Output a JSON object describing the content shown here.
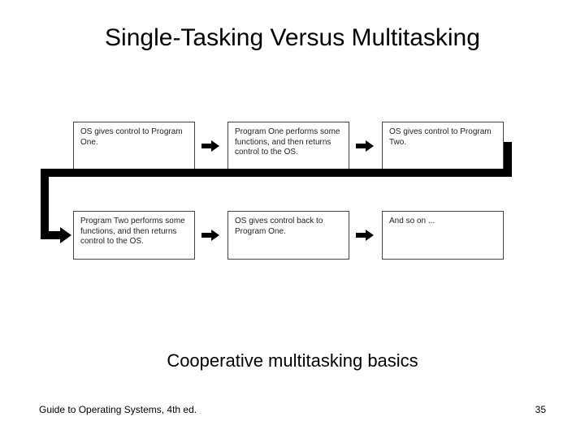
{
  "title": "Single-Tasking Versus Multitasking",
  "caption": "Cooperative multitasking basics",
  "footer_left": "Guide to Operating Systems, 4th ed.",
  "page_number": "35",
  "boxes": {
    "b1": "OS gives control to Program One.",
    "b2": "Program One performs some functions, and then returns control to the OS.",
    "b3": "OS gives control to Program Two.",
    "b4": "Program Two performs some functions, and then returns control to the OS.",
    "b5": "OS gives control back to Program One.",
    "b6": "And so on ..."
  }
}
